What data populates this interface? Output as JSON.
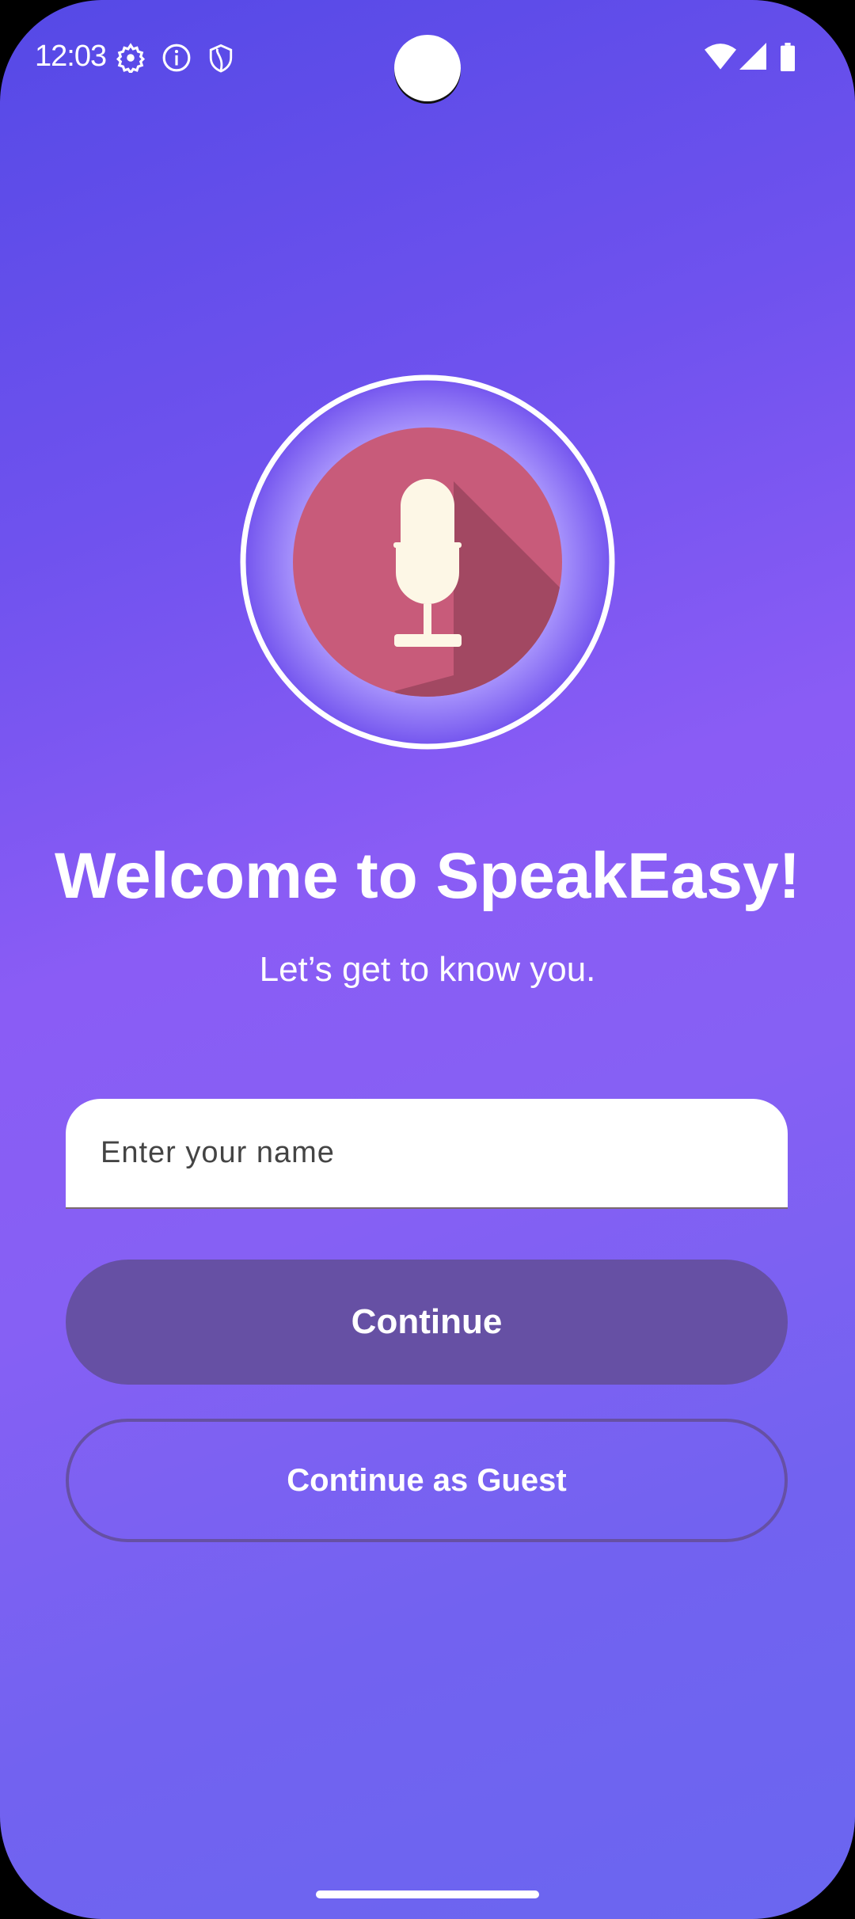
{
  "status_bar": {
    "time": "12:03",
    "left_icons": [
      "gear-icon",
      "info-icon",
      "shield-icon"
    ],
    "right_icons": [
      "wifi-icon",
      "signal-icon",
      "battery-icon"
    ]
  },
  "logo": {
    "icon": "microphone-icon",
    "colors": {
      "circle": "#c85b7a",
      "shadow": "#a24862",
      "mic": "#fdf7e6"
    }
  },
  "welcome": {
    "title": "Welcome to SpeakEasy!",
    "subtitle": "Let’s get to know you."
  },
  "form": {
    "name_placeholder": "Enter your name",
    "name_value": ""
  },
  "buttons": {
    "continue": "Continue",
    "guest": "Continue as Guest"
  },
  "colors": {
    "primary": "#6650a4",
    "background_top": "#5549e6",
    "background_mid": "#8a5cf5"
  }
}
